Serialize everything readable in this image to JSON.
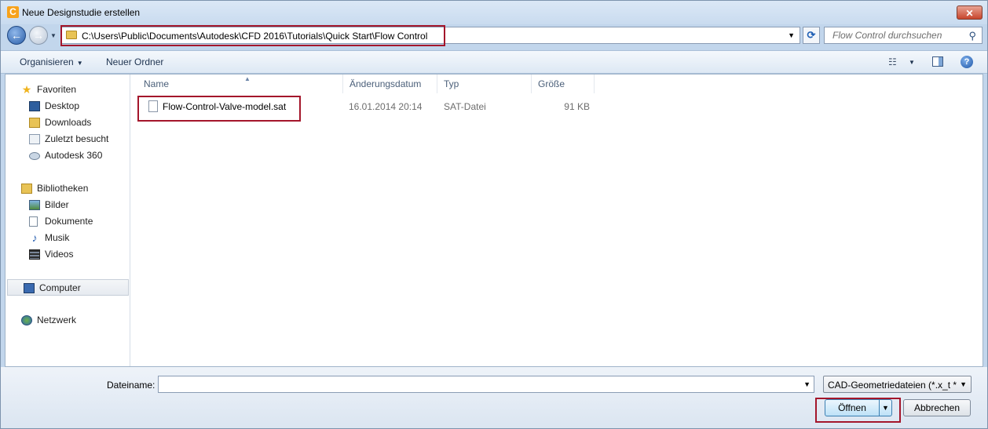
{
  "window": {
    "title": "Neue Designstudie erstellen",
    "app_icon_letter": "C",
    "close_glyph": "✕"
  },
  "nav": {
    "back_glyph": "←",
    "forward_glyph": "→"
  },
  "address": {
    "path": "C:\\Users\\Public\\Documents\\Autodesk\\CFD 2016\\Tutorials\\Quick Start\\Flow Control"
  },
  "search": {
    "placeholder": "Flow Control durchsuchen"
  },
  "toolbar": {
    "organize": "Organisieren",
    "new_folder": "Neuer Ordner"
  },
  "sidebar": {
    "favorites": "Favoriten",
    "desktop": "Desktop",
    "downloads": "Downloads",
    "recent": "Zuletzt besucht",
    "autodesk": "Autodesk 360",
    "libraries": "Bibliotheken",
    "pictures": "Bilder",
    "documents": "Dokumente",
    "music": "Musik",
    "videos": "Videos",
    "computer": "Computer",
    "network": "Netzwerk"
  },
  "columns": {
    "name": "Name",
    "date": "Änderungsdatum",
    "type": "Typ",
    "size": "Größe"
  },
  "files": [
    {
      "name": "Flow-Control-Valve-model.sat",
      "date": "16.01.2014 20:14",
      "type": "SAT-Datei",
      "size": "91 KB"
    }
  ],
  "footer": {
    "filename_label": "Dateiname:",
    "filename_value": "",
    "filter": "CAD-Geometriedateien (*.x_t *.",
    "open": "Öffnen",
    "cancel": "Abbrechen"
  },
  "colors": {
    "highlight": "#a4162b",
    "accent": "#2a5ea8"
  }
}
